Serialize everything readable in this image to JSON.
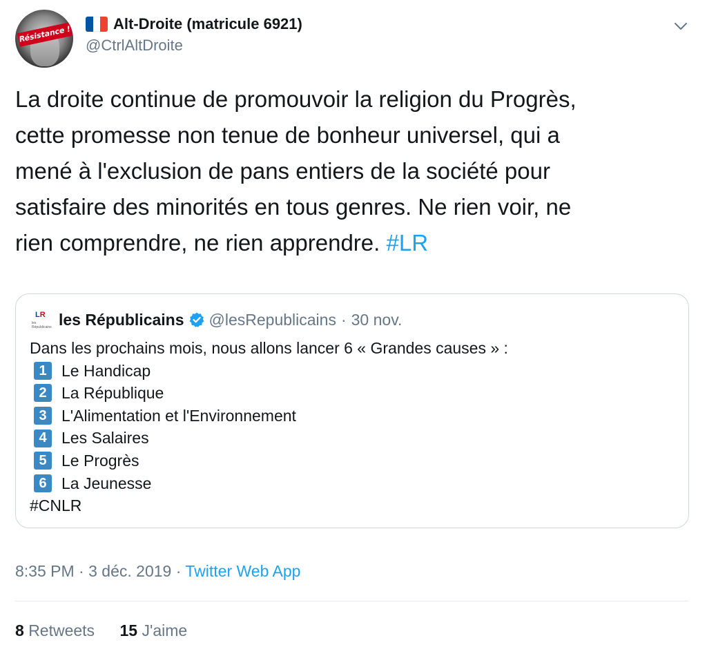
{
  "author": {
    "display_name": "Alt-Droite (matricule 6921)",
    "handle": "@CtrlAltDroite",
    "avatar_badge": "Résistance !",
    "flag_colors": [
      "#0055a4",
      "#ffffff",
      "#ef4135"
    ],
    "menu_icon": "chevron-down-icon"
  },
  "tweet": {
    "text": "La droite continue de promouvoir la religion du Progrès,\ncette promesse non tenue de bonheur universel, qui a\nmené à l'exclusion de pans entiers de la société pour\nsatisfaire des minorités en tous genres. Ne rien voir, ne\nrien comprendre, ne rien apprendre. ",
    "hashtag": "#LR"
  },
  "quoted": {
    "avatar_text": "les Républicains",
    "name": "les Républicains",
    "handle": "@lesRepublicains",
    "separator": "·",
    "date": "30 nov.",
    "intro": "Dans les prochains mois, nous allons lancer 6 « Grandes causes » :",
    "causes": [
      {
        "num": "1",
        "label": "Le Handicap"
      },
      {
        "num": "2",
        "label": "La République"
      },
      {
        "num": "3",
        "label": "L'Alimentation et l'Environnement"
      },
      {
        "num": "4",
        "label": "Les Salaires"
      },
      {
        "num": "5",
        "label": "Le Progrès"
      },
      {
        "num": "6",
        "label": "La Jeunesse"
      }
    ],
    "hashtag": "#CNLR"
  },
  "meta": {
    "time": "8:35 PM",
    "separator": "·",
    "date": "3 déc. 2019",
    "source": "Twitter Web App"
  },
  "stats": {
    "retweets_count": "8",
    "retweets_label": "Retweets",
    "likes_count": "15",
    "likes_label": "J'aime"
  },
  "colors": {
    "accent": "#1da1f2",
    "text": "#14171a",
    "secondary": "#657786",
    "keycap": "#3b88c3",
    "border": "#ccd6dd"
  }
}
